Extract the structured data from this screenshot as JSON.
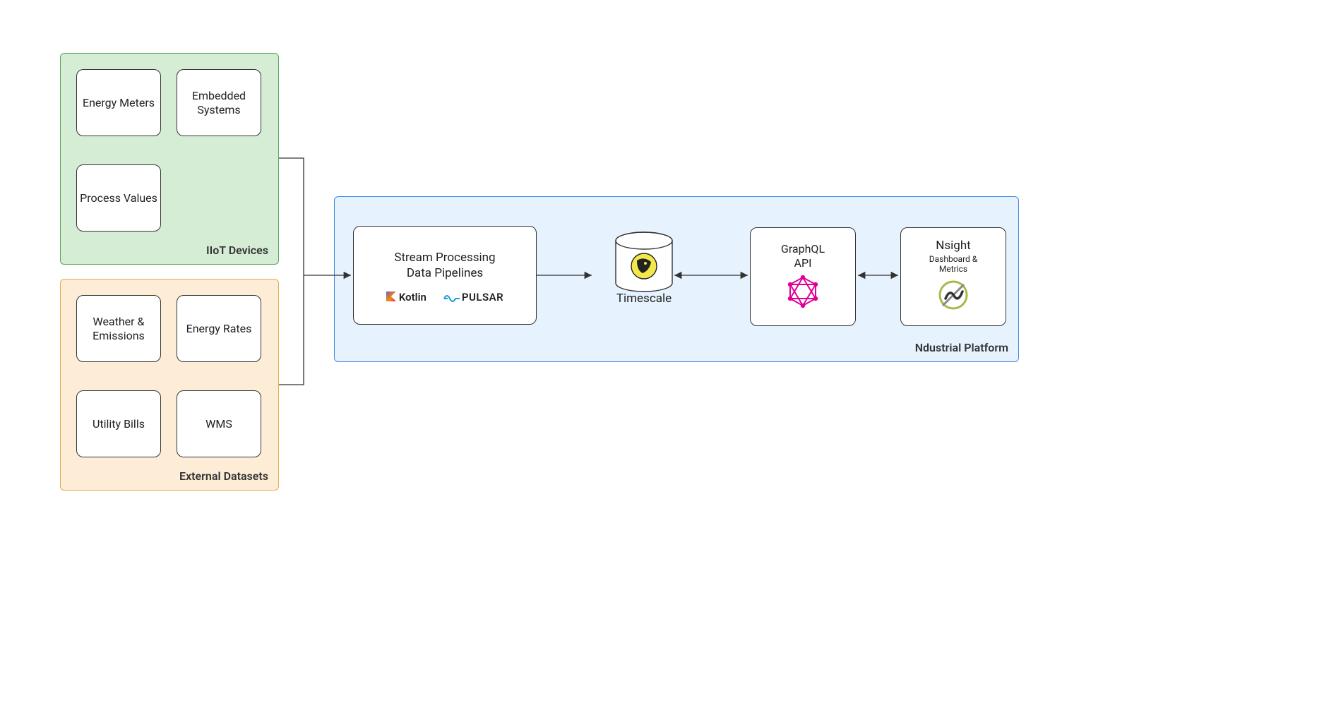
{
  "groups": {
    "iiot": {
      "label": "IIoT Devices"
    },
    "external": {
      "label": "External Datasets"
    },
    "platform": {
      "label": "Ndustrial Platform"
    }
  },
  "iiot_nodes": {
    "energy_meters": "Energy Meters",
    "embedded_systems": "Embedded Systems",
    "process_values": "Process Values"
  },
  "external_nodes": {
    "weather_emissions": "Weather & Emissions",
    "energy_rates": "Energy Rates",
    "utility_bills": "Utility Bills",
    "wms": "WMS"
  },
  "platform_nodes": {
    "stream": {
      "title_line1": "Stream Processing",
      "title_line2": "Data Pipelines",
      "logo_kotlin": "Kotlin",
      "logo_pulsar": "PULSAR"
    },
    "timescale": {
      "label": "Timescale"
    },
    "graphql": {
      "label_line1": "GraphQL",
      "label_line2": "API"
    },
    "nsight": {
      "label": "Nsight",
      "sub_line1": "Dashboard &",
      "sub_line2": "Metrics"
    }
  }
}
